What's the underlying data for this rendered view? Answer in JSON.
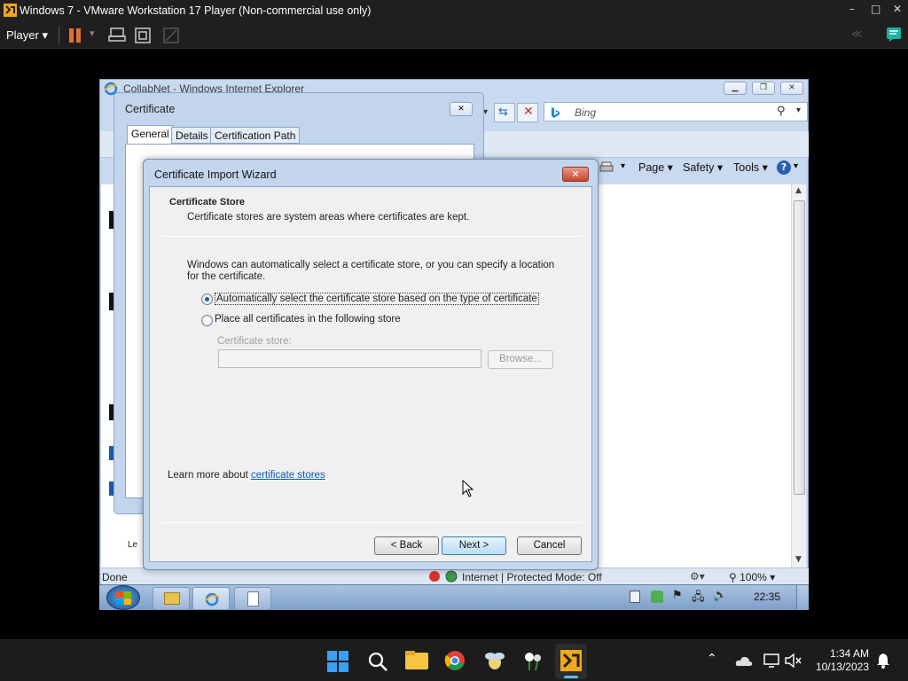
{
  "host_window": {
    "title": "Windows 7 - VMware Workstation 17 Player (Non-commercial use only)",
    "menu_label": "Player",
    "controls": [
      "–",
      "□",
      "✕"
    ]
  },
  "ie": {
    "title": "CollabNet - Windows Internet Explorer",
    "search_placeholder": "Bing",
    "commands": [
      "Page ▾",
      "Safety ▾",
      "Tools ▾"
    ],
    "status_done": "Done",
    "status_zone": "Internet | Protected Mode: Off",
    "zoom": "100%"
  },
  "cert_dialog": {
    "title": "Certificate",
    "tabs": [
      "General",
      "Details",
      "Certification Path"
    ]
  },
  "wizard": {
    "title": "Certificate Import Wizard",
    "heading": "Certificate Store",
    "subheading": "Certificate stores are system areas where certificates are kept.",
    "description": "Windows can automatically select a certificate store, or you can specify a location for the certificate.",
    "option_auto": "Automatically select the certificate store based on the type of certificate",
    "option_manual": "Place all certificates in the following store",
    "selected_option": "auto",
    "store_label": "Certificate store:",
    "store_value": "",
    "browse_label": "Browse...",
    "learn_more_prefix": "Learn more about ",
    "learn_more_link": "certificate stores",
    "back_label": "< Back",
    "next_label": "Next >",
    "cancel_label": "Cancel"
  },
  "guest_taskbar": {
    "time": "22:35"
  },
  "host_taskbar": {
    "time": "1:34 AM",
    "date": "10/13/2023"
  }
}
